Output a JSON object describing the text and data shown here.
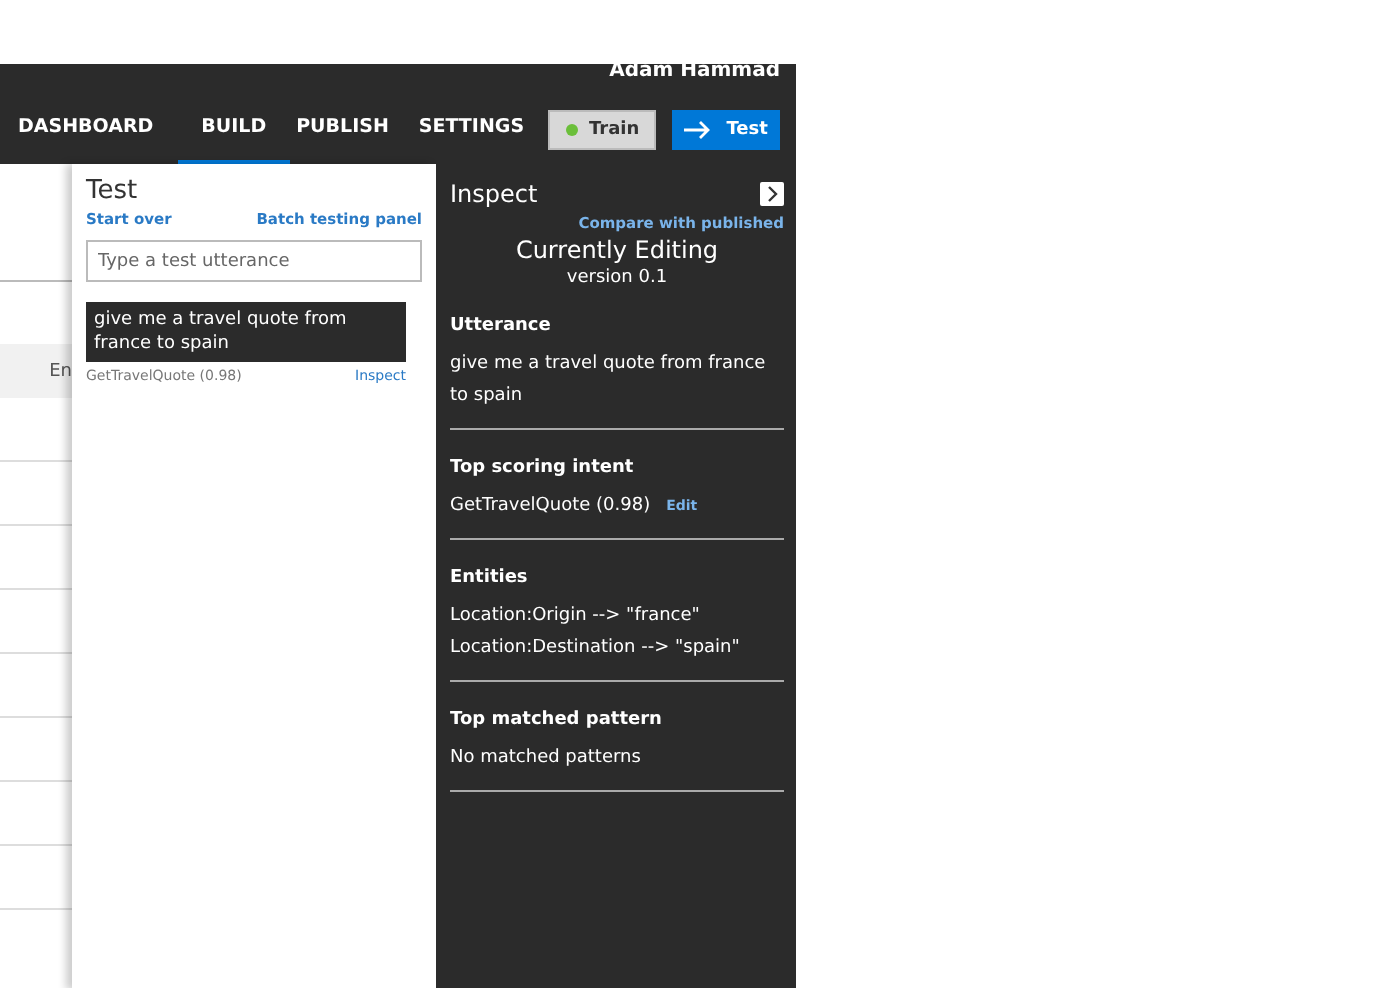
{
  "header": {
    "user_name": "Adam Hammad"
  },
  "nav": {
    "tabs": [
      {
        "label": "DASHBOARD",
        "selected": false
      },
      {
        "label": "BUILD",
        "selected": true
      },
      {
        "label": "PUBLISH",
        "selected": false
      },
      {
        "label": "SETTINGS",
        "selected": false
      }
    ],
    "train_button": "Train",
    "test_button": "Test"
  },
  "background_table": {
    "column_header": "En"
  },
  "test_panel": {
    "title": "Test",
    "start_over": "Start over",
    "batch_link": "Batch testing panel",
    "input": {
      "placeholder": "Type a test utterance"
    },
    "result": {
      "utterance": "give me a travel quote from france to spain",
      "intent": "GetTravelQuote (0.98)",
      "inspect_link": "Inspect"
    }
  },
  "inspect_panel": {
    "title": "Inspect",
    "compare_link": "Compare with published",
    "status": "Currently Editing",
    "version": "version 0.1",
    "sections": [
      {
        "heading": "Utterance",
        "lines": [
          "give me a travel quote from france to spain"
        ]
      },
      {
        "heading": "Top scoring intent",
        "lines": [
          "GetTravelQuote (0.98)"
        ],
        "edit_link": "Edit"
      },
      {
        "heading": "Entities",
        "lines": [
          "Location:Origin --> \"france\"",
          "Location:Destination --> \"spain\""
        ]
      },
      {
        "heading": "Top matched pattern",
        "lines": [
          "No matched patterns"
        ]
      }
    ]
  }
}
